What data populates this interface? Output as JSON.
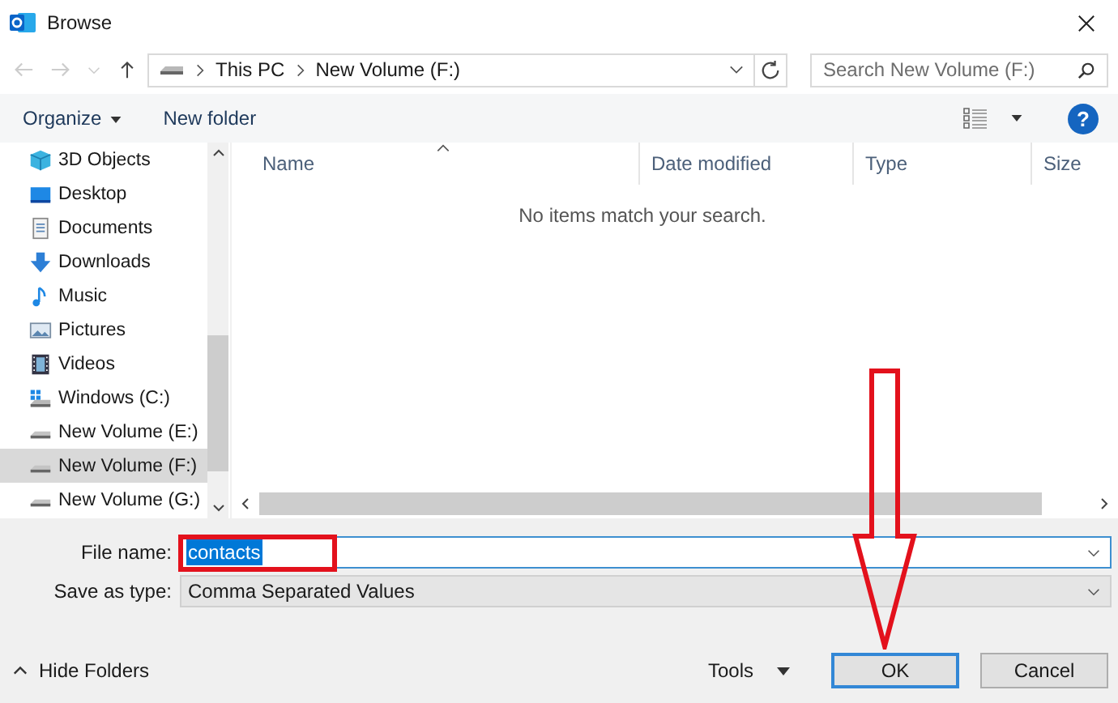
{
  "window": {
    "title": "Browse"
  },
  "address_bar": {
    "path": [
      "This PC",
      "New Volume (F:)"
    ]
  },
  "search": {
    "placeholder": "Search New Volume (F:)"
  },
  "toolbar": {
    "organize": "Organize",
    "new_folder": "New folder",
    "help": "?"
  },
  "sidebar": {
    "items": [
      {
        "label": "3D Objects",
        "kind": "cube",
        "selected": false
      },
      {
        "label": "Desktop",
        "kind": "desktop",
        "selected": false
      },
      {
        "label": "Documents",
        "kind": "document",
        "selected": false
      },
      {
        "label": "Downloads",
        "kind": "download",
        "selected": false
      },
      {
        "label": "Music",
        "kind": "music",
        "selected": false
      },
      {
        "label": "Pictures",
        "kind": "picture",
        "selected": false
      },
      {
        "label": "Videos",
        "kind": "video",
        "selected": false
      },
      {
        "label": "Windows (C:)",
        "kind": "system",
        "selected": false
      },
      {
        "label": "New Volume (E:)",
        "kind": "drive",
        "selected": false
      },
      {
        "label": "New Volume (F:)",
        "kind": "drive",
        "selected": true
      },
      {
        "label": "New Volume (G:)",
        "kind": "drive",
        "selected": false
      }
    ]
  },
  "file_list": {
    "columns": [
      {
        "label": "Name",
        "sorted": true
      },
      {
        "label": "Date modified",
        "sorted": false
      },
      {
        "label": "Type",
        "sorted": false
      },
      {
        "label": "Size",
        "sorted": false
      }
    ],
    "empty_message": "No items match your search."
  },
  "form": {
    "file_name": {
      "label": "File name:",
      "value": "contacts",
      "selected": true
    },
    "save_as_type": {
      "label": "Save as type:",
      "value": "Comma Separated Values"
    }
  },
  "footer": {
    "hide_folders": "Hide Folders",
    "tools": "Tools",
    "buttons": [
      {
        "label": "OK",
        "default": true
      },
      {
        "label": "Cancel",
        "default": false
      }
    ]
  }
}
